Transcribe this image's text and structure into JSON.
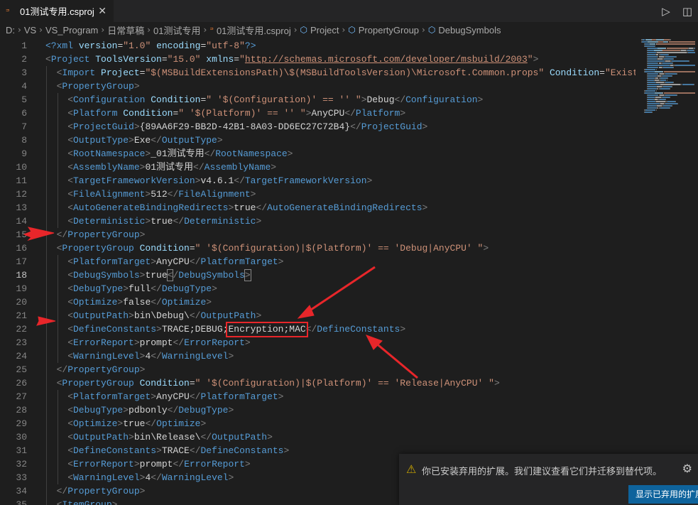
{
  "tab": {
    "title": "01测试专用.csproj",
    "file_icon": "rss-icon",
    "close": "✕"
  },
  "actions": {
    "run": "▷",
    "split": "◫"
  },
  "breadcrumb": [
    "D:",
    "VS",
    "VS_Program",
    "日常草稿",
    "01测试专用",
    "01测试专用.csproj",
    "Project",
    "PropertyGroup",
    "DebugSymbols"
  ],
  "editor": {
    "current_line": "18",
    "lines": [
      {
        "n": "1",
        "i": 0,
        "t": [
          [
            "pi",
            "<?"
          ],
          [
            "n",
            "xml"
          ],
          [
            "a",
            " version"
          ],
          [
            "x",
            "="
          ],
          [
            "s",
            "\"1.0\""
          ],
          [
            "a",
            " encoding"
          ],
          [
            "x",
            "="
          ],
          [
            "s",
            "\"utf-8\""
          ],
          [
            "pi",
            "?>"
          ]
        ]
      },
      {
        "n": "2",
        "i": 0,
        "t": [
          [
            "t",
            "<"
          ],
          [
            "n",
            "Project"
          ],
          [
            "a",
            " ToolsVersion"
          ],
          [
            "x",
            "="
          ],
          [
            "s",
            "\"15.0\""
          ],
          [
            "a",
            " xmlns"
          ],
          [
            "x",
            "="
          ],
          [
            "s",
            "\""
          ],
          [
            "u",
            "http://schemas.microsoft.com/developer/msbuild/2003"
          ],
          [
            "s",
            "\""
          ],
          [
            "t",
            ">"
          ]
        ]
      },
      {
        "n": "3",
        "i": 1,
        "t": [
          [
            "t",
            "<"
          ],
          [
            "n",
            "Import"
          ],
          [
            "a",
            " Project"
          ],
          [
            "x",
            "="
          ],
          [
            "s",
            "\"$(MSBuildExtensionsPath)\\$(MSBuildToolsVersion)\\Microsoft.Common.props\""
          ],
          [
            "a",
            " Condition"
          ],
          [
            "x",
            "="
          ],
          [
            "s",
            "\"Exists"
          ]
        ]
      },
      {
        "n": "4",
        "i": 1,
        "t": [
          [
            "t",
            "<"
          ],
          [
            "n",
            "PropertyGroup"
          ],
          [
            "t",
            ">"
          ]
        ]
      },
      {
        "n": "5",
        "i": 2,
        "t": [
          [
            "t",
            "<"
          ],
          [
            "n",
            "Configuration"
          ],
          [
            "a",
            " Condition"
          ],
          [
            "x",
            "="
          ],
          [
            "s",
            "\" '$(Configuration)' == '' \""
          ],
          [
            "t",
            ">"
          ],
          [
            "x",
            "Debug"
          ],
          [
            "t",
            "</"
          ],
          [
            "n",
            "Configuration"
          ],
          [
            "t",
            ">"
          ]
        ]
      },
      {
        "n": "6",
        "i": 2,
        "t": [
          [
            "t",
            "<"
          ],
          [
            "n",
            "Platform"
          ],
          [
            "a",
            " Condition"
          ],
          [
            "x",
            "="
          ],
          [
            "s",
            "\" '$(Platform)' == '' \""
          ],
          [
            "t",
            ">"
          ],
          [
            "x",
            "AnyCPU"
          ],
          [
            "t",
            "</"
          ],
          [
            "n",
            "Platform"
          ],
          [
            "t",
            ">"
          ]
        ]
      },
      {
        "n": "7",
        "i": 2,
        "t": [
          [
            "t",
            "<"
          ],
          [
            "n",
            "ProjectGuid"
          ],
          [
            "t",
            ">"
          ],
          [
            "x",
            "{89AA6F29-BB2D-42B1-8A03-DD6EC27C72B4}"
          ],
          [
            "t",
            "</"
          ],
          [
            "n",
            "ProjectGuid"
          ],
          [
            "t",
            ">"
          ]
        ]
      },
      {
        "n": "8",
        "i": 2,
        "t": [
          [
            "t",
            "<"
          ],
          [
            "n",
            "OutputType"
          ],
          [
            "t",
            ">"
          ],
          [
            "x",
            "Exe"
          ],
          [
            "t",
            "</"
          ],
          [
            "n",
            "OutputType"
          ],
          [
            "t",
            ">"
          ]
        ]
      },
      {
        "n": "9",
        "i": 2,
        "t": [
          [
            "t",
            "<"
          ],
          [
            "n",
            "RootNamespace"
          ],
          [
            "t",
            ">"
          ],
          [
            "x",
            "_01测试专用"
          ],
          [
            "t",
            "</"
          ],
          [
            "n",
            "RootNamespace"
          ],
          [
            "t",
            ">"
          ]
        ]
      },
      {
        "n": "10",
        "i": 2,
        "t": [
          [
            "t",
            "<"
          ],
          [
            "n",
            "AssemblyName"
          ],
          [
            "t",
            ">"
          ],
          [
            "x",
            "01测试专用"
          ],
          [
            "t",
            "</"
          ],
          [
            "n",
            "AssemblyName"
          ],
          [
            "t",
            ">"
          ]
        ]
      },
      {
        "n": "11",
        "i": 2,
        "t": [
          [
            "t",
            "<"
          ],
          [
            "n",
            "TargetFrameworkVersion"
          ],
          [
            "t",
            ">"
          ],
          [
            "x",
            "v4.6.1"
          ],
          [
            "t",
            "</"
          ],
          [
            "n",
            "TargetFrameworkVersion"
          ],
          [
            "t",
            ">"
          ]
        ]
      },
      {
        "n": "12",
        "i": 2,
        "t": [
          [
            "t",
            "<"
          ],
          [
            "n",
            "FileAlignment"
          ],
          [
            "t",
            ">"
          ],
          [
            "x",
            "512"
          ],
          [
            "t",
            "</"
          ],
          [
            "n",
            "FileAlignment"
          ],
          [
            "t",
            ">"
          ]
        ]
      },
      {
        "n": "13",
        "i": 2,
        "t": [
          [
            "t",
            "<"
          ],
          [
            "n",
            "AutoGenerateBindingRedirects"
          ],
          [
            "t",
            ">"
          ],
          [
            "x",
            "true"
          ],
          [
            "t",
            "</"
          ],
          [
            "n",
            "AutoGenerateBindingRedirects"
          ],
          [
            "t",
            ">"
          ]
        ]
      },
      {
        "n": "14",
        "i": 2,
        "t": [
          [
            "t",
            "<"
          ],
          [
            "n",
            "Deterministic"
          ],
          [
            "t",
            ">"
          ],
          [
            "x",
            "true"
          ],
          [
            "t",
            "</"
          ],
          [
            "n",
            "Deterministic"
          ],
          [
            "t",
            ">"
          ]
        ]
      },
      {
        "n": "15",
        "i": 1,
        "t": [
          [
            "t",
            "</"
          ],
          [
            "n",
            "PropertyGroup"
          ],
          [
            "t",
            ">"
          ]
        ]
      },
      {
        "n": "16",
        "i": 1,
        "t": [
          [
            "t",
            "<"
          ],
          [
            "n",
            "PropertyGroup"
          ],
          [
            "a",
            " Condition"
          ],
          [
            "x",
            "="
          ],
          [
            "s",
            "\" '$(Configuration)|$(Platform)' == 'Debug|AnyCPU' \""
          ],
          [
            "t",
            ">"
          ]
        ]
      },
      {
        "n": "17",
        "i": 2,
        "t": [
          [
            "t",
            "<"
          ],
          [
            "n",
            "PlatformTarget"
          ],
          [
            "t",
            ">"
          ],
          [
            "x",
            "AnyCPU"
          ],
          [
            "t",
            "</"
          ],
          [
            "n",
            "PlatformTarget"
          ],
          [
            "t",
            ">"
          ]
        ]
      },
      {
        "n": "18",
        "i": 2,
        "t": [
          [
            "t",
            "<"
          ],
          [
            "n",
            "DebugSymbols"
          ],
          [
            "t",
            ">"
          ],
          [
            "x",
            "true"
          ],
          [
            "tb",
            "<"
          ],
          [
            "t",
            "/"
          ],
          [
            "n",
            "DebugSymbols"
          ],
          [
            "tb",
            ">"
          ]
        ]
      },
      {
        "n": "19",
        "i": 2,
        "t": [
          [
            "t",
            "<"
          ],
          [
            "n",
            "DebugType"
          ],
          [
            "t",
            ">"
          ],
          [
            "x",
            "full"
          ],
          [
            "t",
            "</"
          ],
          [
            "n",
            "DebugType"
          ],
          [
            "t",
            ">"
          ]
        ]
      },
      {
        "n": "20",
        "i": 2,
        "t": [
          [
            "t",
            "<"
          ],
          [
            "n",
            "Optimize"
          ],
          [
            "t",
            ">"
          ],
          [
            "x",
            "false"
          ],
          [
            "t",
            "</"
          ],
          [
            "n",
            "Optimize"
          ],
          [
            "t",
            ">"
          ]
        ]
      },
      {
        "n": "21",
        "i": 2,
        "t": [
          [
            "t",
            "<"
          ],
          [
            "n",
            "OutputPath"
          ],
          [
            "t",
            ">"
          ],
          [
            "x",
            "bin\\Debug\\"
          ],
          [
            "t",
            "</"
          ],
          [
            "n",
            "OutputPath"
          ],
          [
            "t",
            ">"
          ]
        ]
      },
      {
        "n": "22",
        "i": 2,
        "t": [
          [
            "t",
            "<"
          ],
          [
            "n",
            "DefineConstants"
          ],
          [
            "t",
            ">"
          ],
          [
            "x",
            "TRACE;DEBUG;Encryption;MAC"
          ],
          [
            "t",
            "</"
          ],
          [
            "n",
            "DefineConstants"
          ],
          [
            "t",
            ">"
          ]
        ]
      },
      {
        "n": "23",
        "i": 2,
        "t": [
          [
            "t",
            "<"
          ],
          [
            "n",
            "ErrorReport"
          ],
          [
            "t",
            ">"
          ],
          [
            "x",
            "prompt"
          ],
          [
            "t",
            "</"
          ],
          [
            "n",
            "ErrorReport"
          ],
          [
            "t",
            ">"
          ]
        ]
      },
      {
        "n": "24",
        "i": 2,
        "t": [
          [
            "t",
            "<"
          ],
          [
            "n",
            "WarningLevel"
          ],
          [
            "t",
            ">"
          ],
          [
            "x",
            "4"
          ],
          [
            "t",
            "</"
          ],
          [
            "n",
            "WarningLevel"
          ],
          [
            "t",
            ">"
          ]
        ]
      },
      {
        "n": "25",
        "i": 1,
        "t": [
          [
            "t",
            "</"
          ],
          [
            "n",
            "PropertyGroup"
          ],
          [
            "t",
            ">"
          ]
        ]
      },
      {
        "n": "26",
        "i": 1,
        "t": [
          [
            "t",
            "<"
          ],
          [
            "n",
            "PropertyGroup"
          ],
          [
            "a",
            " Condition"
          ],
          [
            "x",
            "="
          ],
          [
            "s",
            "\" '$(Configuration)|$(Platform)' == 'Release|AnyCPU' \""
          ],
          [
            "t",
            ">"
          ]
        ]
      },
      {
        "n": "27",
        "i": 2,
        "t": [
          [
            "t",
            "<"
          ],
          [
            "n",
            "PlatformTarget"
          ],
          [
            "t",
            ">"
          ],
          [
            "x",
            "AnyCPU"
          ],
          [
            "t",
            "</"
          ],
          [
            "n",
            "PlatformTarget"
          ],
          [
            "t",
            ">"
          ]
        ]
      },
      {
        "n": "28",
        "i": 2,
        "t": [
          [
            "t",
            "<"
          ],
          [
            "n",
            "DebugType"
          ],
          [
            "t",
            ">"
          ],
          [
            "x",
            "pdbonly"
          ],
          [
            "t",
            "</"
          ],
          [
            "n",
            "DebugType"
          ],
          [
            "t",
            ">"
          ]
        ]
      },
      {
        "n": "29",
        "i": 2,
        "t": [
          [
            "t",
            "<"
          ],
          [
            "n",
            "Optimize"
          ],
          [
            "t",
            ">"
          ],
          [
            "x",
            "true"
          ],
          [
            "t",
            "</"
          ],
          [
            "n",
            "Optimize"
          ],
          [
            "t",
            ">"
          ]
        ]
      },
      {
        "n": "30",
        "i": 2,
        "t": [
          [
            "t",
            "<"
          ],
          [
            "n",
            "OutputPath"
          ],
          [
            "t",
            ">"
          ],
          [
            "x",
            "bin\\Release\\"
          ],
          [
            "t",
            "</"
          ],
          [
            "n",
            "OutputPath"
          ],
          [
            "t",
            ">"
          ]
        ]
      },
      {
        "n": "31",
        "i": 2,
        "t": [
          [
            "t",
            "<"
          ],
          [
            "n",
            "DefineConstants"
          ],
          [
            "t",
            ">"
          ],
          [
            "x",
            "TRACE"
          ],
          [
            "t",
            "</"
          ],
          [
            "n",
            "DefineConstants"
          ],
          [
            "t",
            ">"
          ]
        ]
      },
      {
        "n": "32",
        "i": 2,
        "t": [
          [
            "t",
            "<"
          ],
          [
            "n",
            "ErrorReport"
          ],
          [
            "t",
            ">"
          ],
          [
            "x",
            "prompt"
          ],
          [
            "t",
            "</"
          ],
          [
            "n",
            "ErrorReport"
          ],
          [
            "t",
            ">"
          ]
        ]
      },
      {
        "n": "33",
        "i": 2,
        "t": [
          [
            "t",
            "<"
          ],
          [
            "n",
            "WarningLevel"
          ],
          [
            "t",
            ">"
          ],
          [
            "x",
            "4"
          ],
          [
            "t",
            "</"
          ],
          [
            "n",
            "WarningLevel"
          ],
          [
            "t",
            ">"
          ]
        ]
      },
      {
        "n": "34",
        "i": 1,
        "t": [
          [
            "t",
            "</"
          ],
          [
            "n",
            "PropertyGroup"
          ],
          [
            "t",
            ">"
          ]
        ]
      },
      {
        "n": "35",
        "i": 1,
        "t": [
          [
            "t",
            "<"
          ],
          [
            "n",
            "ItemGroup"
          ],
          [
            "t",
            ">"
          ]
        ]
      }
    ]
  },
  "notification": {
    "icon": "warning-icon",
    "message": "你已安装弃用的扩展。我们建议查看它们并迁移到替代项。",
    "button": "显示已弃用的扩展",
    "gear": "⚙"
  },
  "colors": {
    "annotation_red": "#e8262a",
    "accent_blue": "#0e639c"
  }
}
